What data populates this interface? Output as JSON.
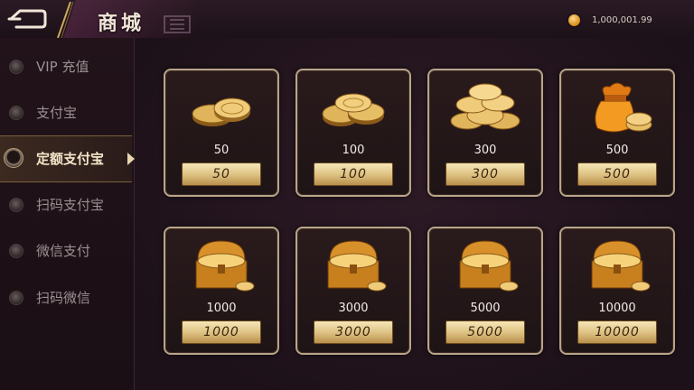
{
  "header": {
    "title": "商城",
    "balance": "1,000,001.99"
  },
  "sidebar": {
    "items": [
      {
        "label": "VIP 充值"
      },
      {
        "label": "支付宝"
      },
      {
        "label": "定额支付宝"
      },
      {
        "label": "扫码支付宝"
      },
      {
        "label": "微信支付"
      },
      {
        "label": "扫码微信"
      }
    ],
    "active_index": 2
  },
  "products": [
    {
      "amount": "50",
      "price": "50",
      "icon": "gold-coins-small-icon"
    },
    {
      "amount": "100",
      "price": "100",
      "icon": "gold-coins-pile-icon"
    },
    {
      "amount": "300",
      "price": "300",
      "icon": "gold-coins-large-pile-icon"
    },
    {
      "amount": "500",
      "price": "500",
      "icon": "gold-money-bag-icon"
    },
    {
      "amount": "1000",
      "price": "1000",
      "icon": "treasure-chest-icon"
    },
    {
      "amount": "3000",
      "price": "3000",
      "icon": "treasure-chest-icon"
    },
    {
      "amount": "5000",
      "price": "5000",
      "icon": "treasure-chest-icon"
    },
    {
      "amount": "10000",
      "price": "10000",
      "icon": "treasure-chest-icon"
    }
  ],
  "colors": {
    "accent_gold": "#dcbf80",
    "card_border": "#b8a48a",
    "background": "#1a0f16"
  }
}
